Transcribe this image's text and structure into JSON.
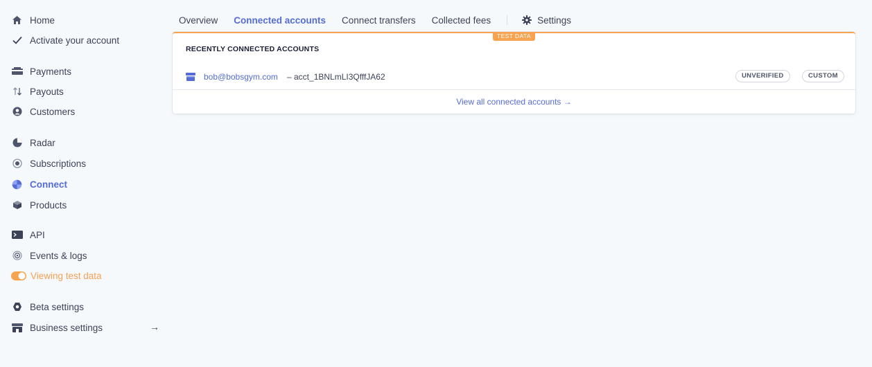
{
  "sidebar": {
    "items": [
      {
        "label": "Home",
        "icon": "home-icon"
      },
      {
        "label": "Activate your account",
        "icon": "checkmark-icon"
      },
      {
        "label": "Payments",
        "icon": "payments-icon"
      },
      {
        "label": "Payouts",
        "icon": "payouts-icon"
      },
      {
        "label": "Customers",
        "icon": "customers-icon"
      },
      {
        "label": "Radar",
        "icon": "radar-icon"
      },
      {
        "label": "Subscriptions",
        "icon": "subscriptions-icon"
      },
      {
        "label": "Connect",
        "icon": "connect-icon"
      },
      {
        "label": "Products",
        "icon": "products-icon"
      },
      {
        "label": "API",
        "icon": "api-icon"
      },
      {
        "label": "Events & logs",
        "icon": "events-icon"
      },
      {
        "label": "Viewing test data",
        "icon": "toggle-icon"
      },
      {
        "label": "Beta settings",
        "icon": "beta-icon"
      },
      {
        "label": "Business settings",
        "icon": "business-icon"
      }
    ],
    "business_arrow": "→"
  },
  "tabs": {
    "overview": "Overview",
    "connected_accounts": "Connected accounts",
    "connect_transfers": "Connect transfers",
    "collected_fees": "Collected fees",
    "settings": "Settings"
  },
  "card": {
    "test_badge": "TEST DATA",
    "title": "RECENTLY CONNECTED ACCOUNTS",
    "account": {
      "email": "bob@bobsgym.com",
      "id": " – acct_1BNLmLI3QfffJA62",
      "status_badge": "UNVERIFIED",
      "type_badge": "CUSTOM"
    },
    "view_all": "View all connected accounts →"
  },
  "colors": {
    "accent": "#556cd6",
    "test_orange": "#f8a34f",
    "background": "#f6f9fc",
    "text": "#3c4257"
  }
}
